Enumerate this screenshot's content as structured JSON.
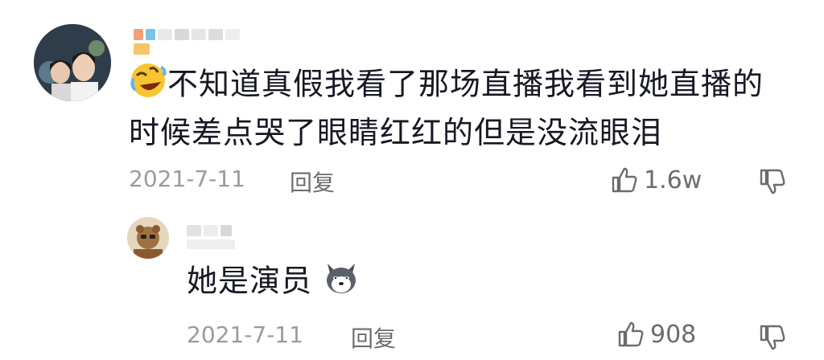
{
  "comments": [
    {
      "text_line1": "不知道真假我看了那场直播我看到她直播的",
      "text_line2": "时候差点哭了眼睛红红的但是没流眼泪",
      "date": "2021-7-11",
      "reply_label": "回复",
      "likes": "1.6w",
      "emoji_icon": "rolling-laughing-emoji-icon"
    },
    {
      "text": "她是演员",
      "date": "2021-7-11",
      "reply_label": "回复",
      "likes": "908",
      "emoji_icon": "husky-dog-emoji-icon"
    }
  ],
  "colors": {
    "text": "#161823",
    "meta": "#9a9ba0",
    "action": "#6b6c70"
  }
}
